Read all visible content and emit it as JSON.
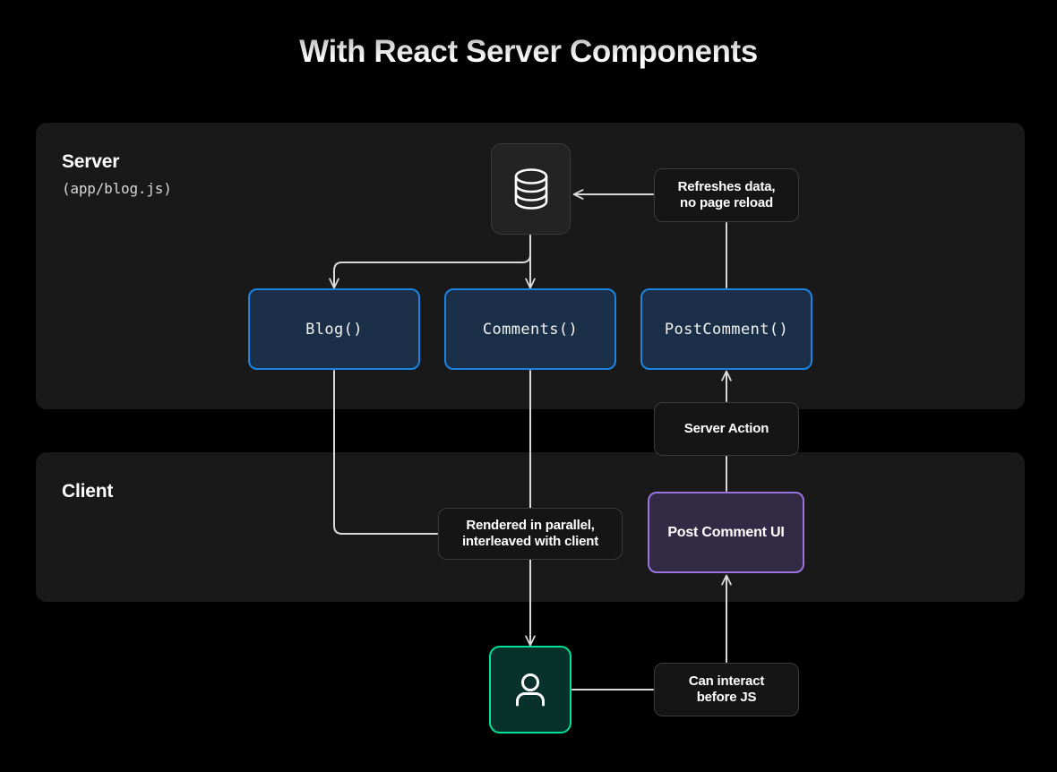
{
  "title": "With React Server Components",
  "colors": {
    "background": "#000000",
    "panel": "#191919",
    "server_component_border": "#1a84e0",
    "server_component_fill": "#1b3048",
    "client_component_border": "#9b72e0",
    "client_component_fill": "#332a46",
    "user_border": "#00e29a",
    "user_fill": "#07312a",
    "wire": "#d9d9d9",
    "title_text": "#ffffff"
  },
  "panels": {
    "server": {
      "title": "Server",
      "subtitle": "(app/blog.js)"
    },
    "client": {
      "title": "Client"
    }
  },
  "nodes": {
    "database": {
      "icon": "database-icon"
    },
    "blog": {
      "label": "Blog()"
    },
    "comments": {
      "label": "Comments()"
    },
    "post_comment": {
      "label": "PostComment()"
    },
    "post_comment_ui": {
      "label": "Post Comment UI"
    },
    "user": {
      "icon": "user-icon"
    }
  },
  "annotations": {
    "refreshes_data": {
      "line1": "Refreshes data,",
      "line2": "no page reload"
    },
    "server_action": {
      "line1": "Server Action",
      "line2": ""
    },
    "rendered_parallel": {
      "line1": "Rendered in parallel,",
      "line2": "interleaved with client"
    },
    "can_interact": {
      "line1": "Can interact",
      "line2": "before JS"
    }
  }
}
